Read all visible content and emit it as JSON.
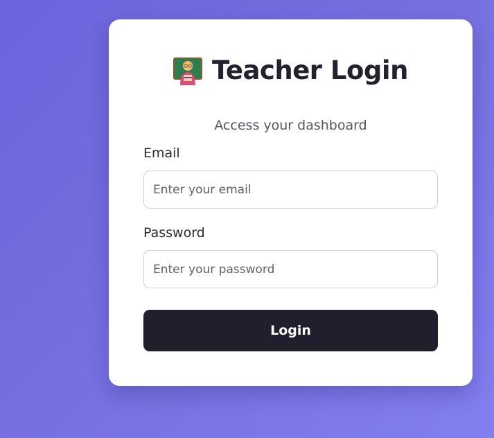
{
  "header": {
    "icon": "teacher-emoji-icon",
    "title": "Teacher Login",
    "subtitle": "Access your dashboard"
  },
  "form": {
    "email": {
      "label": "Email",
      "placeholder": "Enter your email",
      "value": ""
    },
    "password": {
      "label": "Password",
      "placeholder": "Enter your password",
      "value": ""
    },
    "submit_label": "Login"
  },
  "colors": {
    "background_start": "#6b64dc",
    "background_end": "#827ff0",
    "card": "#ffffff",
    "button": "#1f1f2d",
    "title_text": "#22212f"
  }
}
